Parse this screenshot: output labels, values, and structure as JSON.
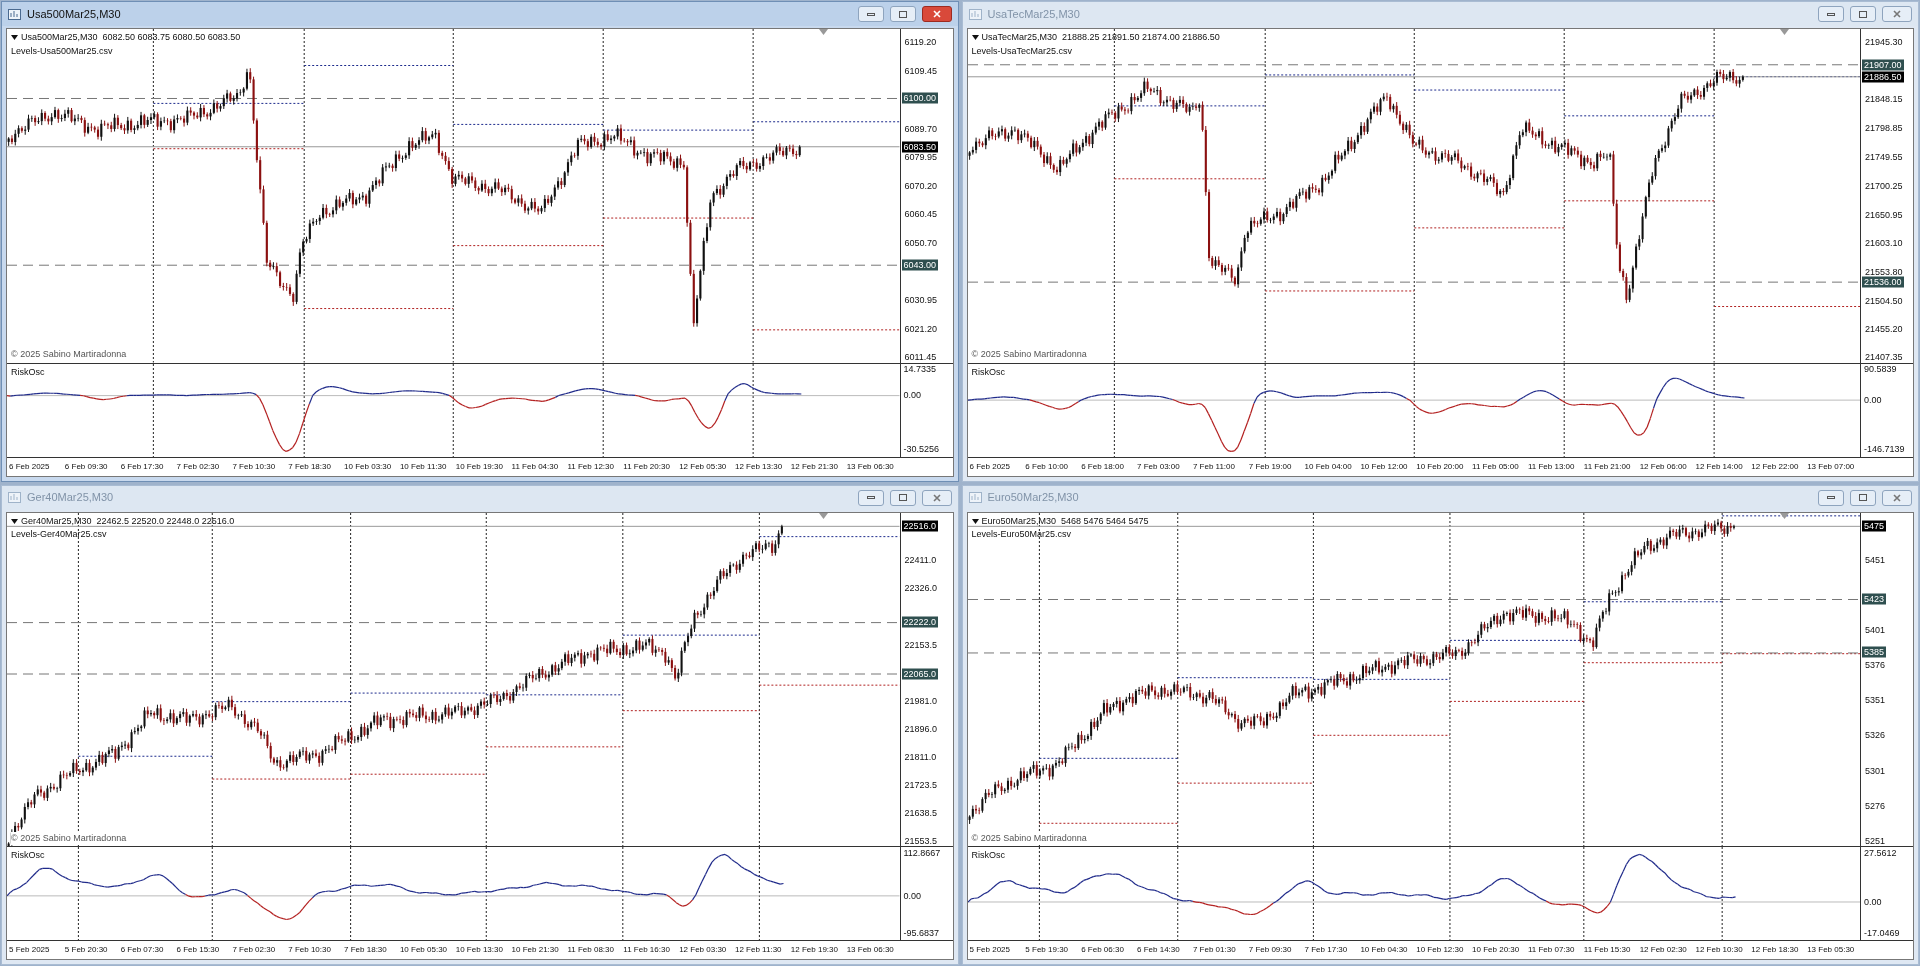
{
  "windows": [
    {
      "title": "Usa500Mar25,M30",
      "active": true,
      "quote": "Usa500Mar25,M30  6082.50 6083.75 6080.50 6083.50",
      "levels_file": "Levels-Usa500Mar25.csv",
      "copyright": "© 2025 Sabino Martiradonna",
      "price_ticks": [
        "6119.20",
        "6109.45",
        "6089.70",
        "6079.95",
        "6070.20",
        "6060.45",
        "6050.70",
        "6030.95",
        "6021.20",
        "6011.45"
      ],
      "level_tags": [
        "6100.00",
        "6043.00"
      ],
      "current_price": "6083.50",
      "indicator": {
        "name": "RiskOsc",
        "ticks": [
          "14.7335",
          "0.00",
          "-30.5256"
        ]
      },
      "time_labels": [
        "6 Feb 2025",
        "6 Feb 09:30",
        "6 Feb 17:30",
        "7 Feb 02:30",
        "7 Feb 10:30",
        "7 Feb 18:30",
        "10 Feb 03:30",
        "10 Feb 11:30",
        "10 Feb 19:30",
        "11 Feb 04:30",
        "11 Feb 12:30",
        "11 Feb 20:30",
        "12 Feb 05:30",
        "12 Feb 13:30",
        "12 Feb 21:30",
        "13 Feb 06:30"
      ]
    },
    {
      "title": "UsaTecMar25,M30",
      "active": false,
      "quote": "UsaTecMar25,M30  21888.25 21891.50 21874.00 21886.50",
      "levels_file": "Levels-UsaTecMar25.csv",
      "copyright": "© 2025 Sabino Martiradonna",
      "price_ticks": [
        "21945.30",
        "21848.15",
        "21798.85",
        "21749.55",
        "21700.25",
        "21650.95",
        "21603.10",
        "21553.80",
        "21504.50",
        "21455.20",
        "21407.35"
      ],
      "level_tags": [
        "21907.00",
        "21536.00"
      ],
      "current_price": "21886.50",
      "indicator": {
        "name": "RiskOsc",
        "ticks": [
          "90.5839",
          "0.00",
          "-146.7139"
        ]
      },
      "time_labels": [
        "6 Feb 2025",
        "6 Feb 10:00",
        "6 Feb 18:00",
        "7 Feb 03:00",
        "7 Feb 11:00",
        "7 Feb 19:00",
        "10 Feb 04:00",
        "10 Feb 12:00",
        "10 Feb 20:00",
        "11 Feb 05:00",
        "11 Feb 13:00",
        "11 Feb 21:00",
        "12 Feb 06:00",
        "12 Feb 14:00",
        "12 Feb 22:00",
        "13 Feb 07:00"
      ]
    },
    {
      "title": "Ger40Mar25,M30",
      "active": false,
      "quote": "Ger40Mar25,M30  22462.5 22520.0 22448.0 22516.0",
      "levels_file": "Levels-Ger40Mar25.csv",
      "copyright": "© 2025 Sabino Martiradonna",
      "price_ticks": [
        "22411.0",
        "22326.0",
        "22153.5",
        "21981.0",
        "21896.0",
        "21811.0",
        "21723.5",
        "21638.5",
        "21553.5"
      ],
      "level_tags": [
        "22222.0",
        "22065.0"
      ],
      "current_price": "22516.0",
      "indicator": {
        "name": "RiskOsc",
        "ticks": [
          "112.8667",
          "0.00",
          "-95.6837"
        ]
      },
      "time_labels": [
        "5 Feb 2025",
        "5 Feb 20:30",
        "6 Feb 07:30",
        "6 Feb 15:30",
        "7 Feb 02:30",
        "7 Feb 10:30",
        "7 Feb 18:30",
        "10 Feb 05:30",
        "10 Feb 13:30",
        "10 Feb 21:30",
        "11 Feb 08:30",
        "11 Feb 16:30",
        "12 Feb 03:30",
        "12 Feb 11:30",
        "12 Feb 19:30",
        "13 Feb 06:30"
      ]
    },
    {
      "title": "Euro50Mar25,M30",
      "active": false,
      "quote": "Euro50Mar25,M30  5468 5476 5464 5475",
      "levels_file": "Levels-Euro50Mar25.csv",
      "copyright": "© 2025 Sabino Martiradonna",
      "price_ticks": [
        "5451",
        "5401",
        "5376",
        "5351",
        "5326",
        "5301",
        "5276",
        "5251"
      ],
      "level_tags": [
        "5423",
        "5385"
      ],
      "current_price": "5475",
      "indicator": {
        "name": "RiskOsc",
        "ticks": [
          "27.5612",
          "0.00",
          "-17.0469"
        ]
      },
      "time_labels": [
        "5 Feb 2025",
        "5 Feb 19:30",
        "6 Feb 06:30",
        "6 Feb 14:30",
        "7 Feb 01:30",
        "7 Feb 09:30",
        "7 Feb 17:30",
        "10 Feb 04:30",
        "10 Feb 12:30",
        "10 Feb 20:30",
        "11 Feb 07:30",
        "11 Feb 15:30",
        "12 Feb 02:30",
        "12 Feb 10:30",
        "12 Feb 18:30",
        "13 Feb 05:30"
      ]
    }
  ]
}
